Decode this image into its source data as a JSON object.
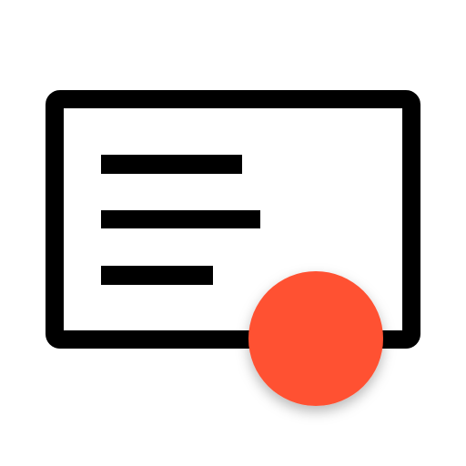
{
  "icon": {
    "name": "document-card-with-notification-badge",
    "frame_icon": "card-outline-icon",
    "lines_icon": "text-lines-icon",
    "badge_icon": "notification-dot-icon"
  },
  "colors": {
    "background": "#ffffff",
    "outline": "#000000",
    "card_fill": "#ffffff",
    "badge": "#ff5133",
    "badge_shadow": "rgba(0,0,0,0.28)"
  }
}
